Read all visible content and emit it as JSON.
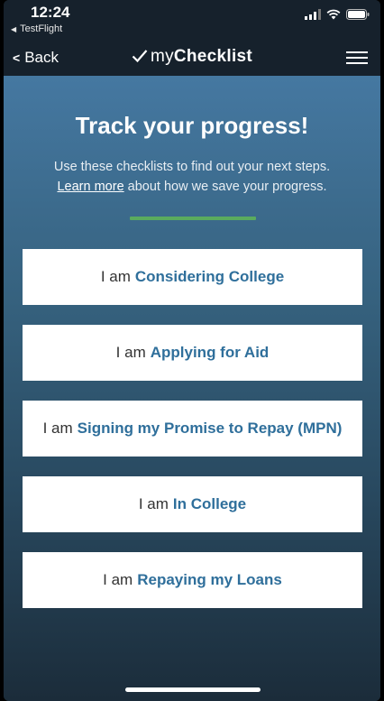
{
  "status_bar": {
    "time": "12:24",
    "back_app": "TestFlight"
  },
  "nav": {
    "back_label": "Back",
    "title_prefix": "my",
    "title_bold": "Checklist"
  },
  "main": {
    "headline": "Track your progress!",
    "subtext_line1": "Use these checklists to find out your next steps.",
    "learn_more": "Learn more",
    "subtext_line2_rest": "about how we save your progress.",
    "options": [
      {
        "prefix": "I am",
        "label": "Considering College"
      },
      {
        "prefix": "I am",
        "label": "Applying for Aid"
      },
      {
        "prefix": "I am",
        "label": "Signing my Promise to Repay (MPN)"
      },
      {
        "prefix": "I am",
        "label": "In College"
      },
      {
        "prefix": "I am",
        "label": "Repaying my Loans"
      }
    ]
  },
  "colors": {
    "accent_link": "#2f6f9b",
    "divider_green": "#5aab5e",
    "nav_background": "#16212c"
  }
}
